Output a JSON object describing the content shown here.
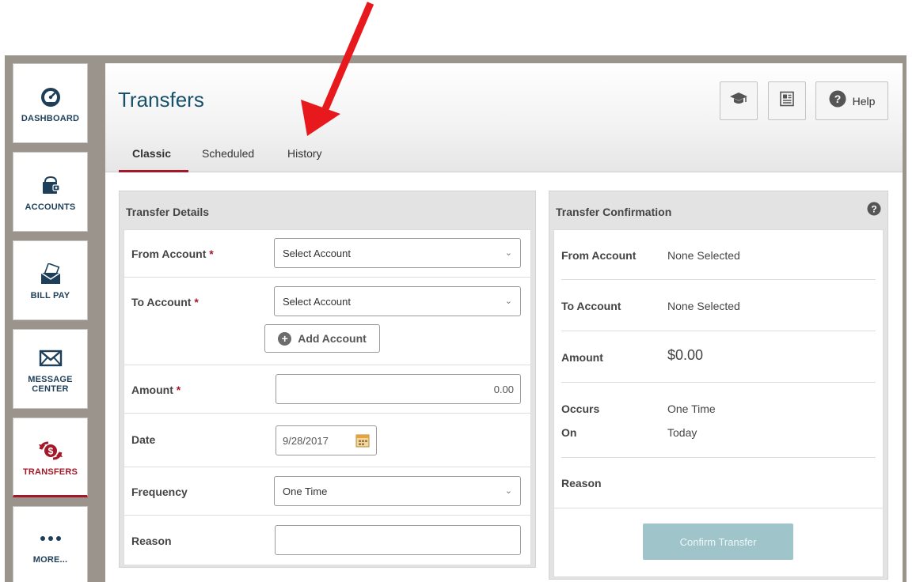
{
  "sidebar": {
    "items": [
      {
        "label": "DASHBOARD",
        "icon": "dashboard-gauge-icon"
      },
      {
        "label": "ACCOUNTS",
        "icon": "wallet-icon"
      },
      {
        "label": "BILL PAY",
        "icon": "envelope-bill-icon"
      },
      {
        "label": "MESSAGE\nCENTER",
        "icon": "envelope-icon"
      },
      {
        "label": "TRANSFERS",
        "icon": "transfer-dollar-icon",
        "active": true
      },
      {
        "label": "MORE...",
        "icon": "ellipsis-icon"
      }
    ]
  },
  "header": {
    "title": "Transfers",
    "help_label": "Help",
    "tabs": [
      {
        "label": "Classic",
        "active": true
      },
      {
        "label": "Scheduled"
      },
      {
        "label": "History"
      }
    ]
  },
  "details": {
    "title": "Transfer Details",
    "from_label": "From Account",
    "from_value": "Select Account",
    "to_label": "To Account",
    "to_value": "Select Account",
    "add_account_label": "Add Account",
    "amount_label": "Amount",
    "amount_placeholder": "0.00",
    "date_label": "Date",
    "date_value": "9/28/2017",
    "frequency_label": "Frequency",
    "frequency_value": "One Time",
    "reason_label": "Reason",
    "required_marker": "*"
  },
  "confirmation": {
    "title": "Transfer Confirmation",
    "from_label": "From Account",
    "from_value": "None Selected",
    "to_label": "To Account",
    "to_value": "None Selected",
    "amount_label": "Amount",
    "amount_value": "$0.00",
    "occurs_label": "Occurs",
    "occurs_value": "One Time",
    "on_label": "On",
    "on_value": "Today",
    "reason_label": "Reason",
    "confirm_label": "Confirm Transfer"
  },
  "colors": {
    "brand_red": "#a3192a",
    "title_teal": "#17506b",
    "confirm_disabled": "#9fc5cb",
    "annotation_arrow": "#e8191c"
  }
}
